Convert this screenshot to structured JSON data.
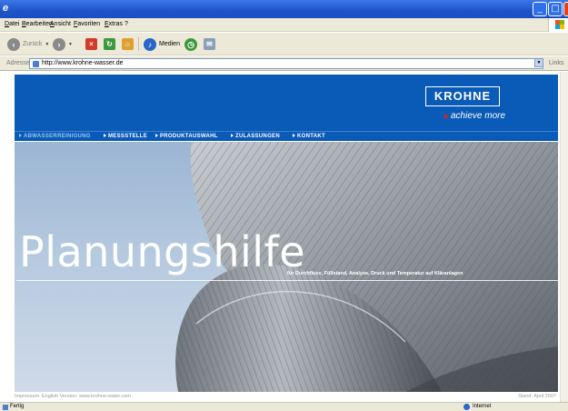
{
  "window": {
    "title_icon": "ie-icon",
    "buttons": {
      "minimize": "_",
      "maximize": "□",
      "close": "✕"
    }
  },
  "menu": [
    "Datei",
    "Bearbeiten",
    "Ansicht",
    "Favoriten",
    "Extras",
    "?"
  ],
  "toolbar": {
    "back_label": "Zurück",
    "media_label": "Medien"
  },
  "address": {
    "label": "Adresse",
    "url": "http://www.krohne-wasser.de",
    "links_label": "Links"
  },
  "site": {
    "logo": "KROHNE",
    "slogan": "achieve more",
    "nav": [
      {
        "label": "ABWASSERREINIGUNG",
        "active": true
      },
      {
        "label": "MESSSTELLE",
        "active": false
      },
      {
        "label": "PRODUKTAUSWAHL",
        "active": false
      },
      {
        "label": "ZULASSUNGEN",
        "active": false
      },
      {
        "label": "KONTAKT",
        "active": false
      }
    ],
    "hero_title": "Planungshilfe",
    "hero_subtitle": "für Durchfluss, Füllstand, Analyse, Druck und Temperatur auf Kläranlagen",
    "footer": {
      "impressum": "Impressum",
      "english": "English Version: www.krohne-water.com",
      "date": "Stand: April 2007"
    }
  },
  "status": {
    "text": "Fertig",
    "zone": "Internet"
  },
  "colors": {
    "brand_blue": "#0a5bb8",
    "accent_red": "#d6261e"
  }
}
